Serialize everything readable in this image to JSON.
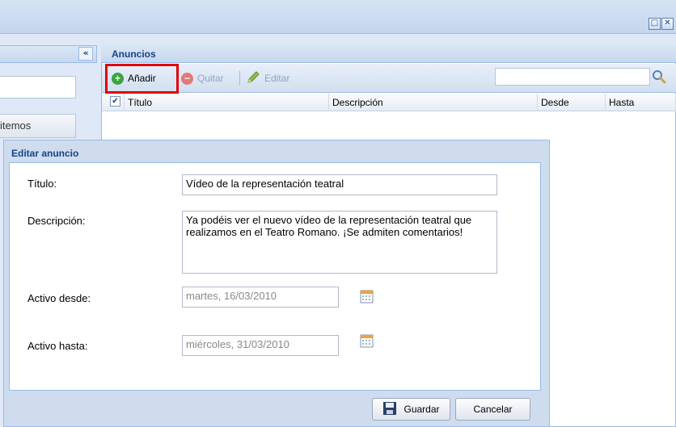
{
  "left": {
    "button_label": "itemos"
  },
  "main": {
    "title": "Anuncios",
    "toolbar": {
      "add_label": "Añadir",
      "remove_label": "Quitar",
      "edit_label": "Editar"
    },
    "columns": [
      "Título",
      "Descripción",
      "Desde",
      "Hasta"
    ]
  },
  "dialog": {
    "title": "Editar anuncio",
    "fields": {
      "titulo_label": "Título:",
      "titulo_value": "Vídeo de la representación teatral",
      "descripcion_label": "Descripción:",
      "descripcion_value": "Ya podéis ver el nuevo vídeo de la representación teatral que realizamos en el Teatro Romano. ¡Se admiten comentarios!",
      "desde_label": "Activo desde:",
      "desde_value": "martes, 16/03/2010",
      "hasta_label": "Activo hasta:",
      "hasta_value": "miércoles, 31/03/2010"
    },
    "save_label": "Guardar",
    "cancel_label": "Cancelar"
  },
  "icons": {
    "collapse": "«",
    "checkbox": "✔",
    "add": "+",
    "remove": "−"
  },
  "colors": {
    "add_icon": "#3aa53a",
    "remove_icon": "#e07a7a",
    "highlight": "#e00000",
    "header_text": "#15428b"
  }
}
